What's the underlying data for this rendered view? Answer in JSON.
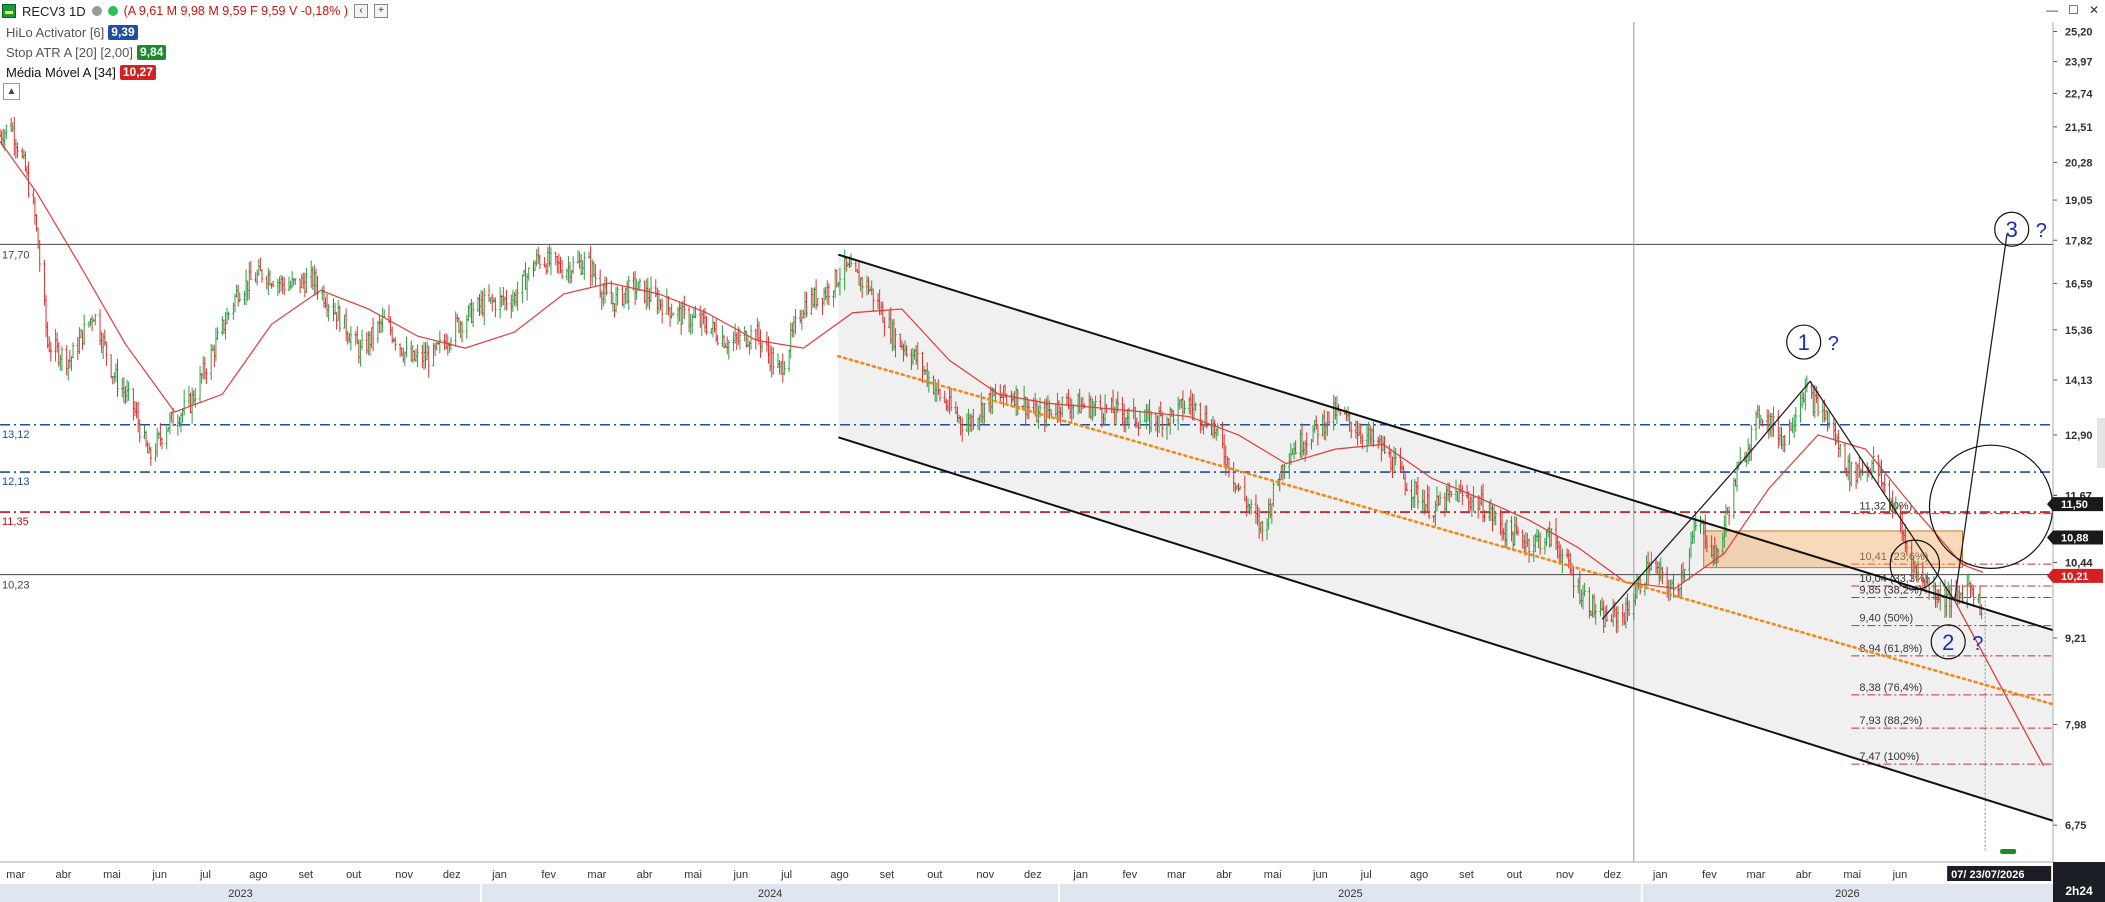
{
  "window": {
    "symbol": "RECV3 1D",
    "ohlc_text": "(A 9,61 M 9,98 M 9,59 F 9,59 V -0,18% )",
    "chevron_label": "‹",
    "add_label": "+",
    "min_label": "—",
    "max_label": "☐",
    "close_label": "✕",
    "collapse_label": "▲",
    "corner_label": "2h24"
  },
  "indicators": [
    {
      "label": "HiLo Activator [6]",
      "badge": "9,39",
      "badge_color": "#1f4fa0",
      "text_color": "#555555"
    },
    {
      "label": "Stop ATR A [20] [2,00]",
      "badge": "9,84",
      "badge_color": "#1c8a2e",
      "text_color": "#555555"
    },
    {
      "label": "Média Móvel A [34]",
      "badge": "10,27",
      "badge_color": "#d42020",
      "text_color": "#111111"
    }
  ],
  "colors": {
    "up": "#2e9e44",
    "down": "#d63434",
    "ma": "#e03c3c",
    "blue_dash": "#1f4fa0",
    "red_dash": "#c0101a",
    "orange": "#f08a1a",
    "channel_fill": "#f0f0f0",
    "fib_line": "#c03030",
    "wave": "#1d2db8"
  },
  "chart_data": {
    "type": "candlestick",
    "yscale": "log",
    "ylim": [
      6.35,
      25.6
    ],
    "x_range": [
      "2023-02-20",
      "2026-09-05"
    ],
    "y_ticks": [
      25.2,
      23.97,
      22.74,
      21.51,
      20.28,
      19.05,
      17.82,
      16.59,
      15.36,
      14.13,
      12.9,
      11.67,
      10.44,
      9.21,
      7.98,
      6.75
    ],
    "y_tick_labels": [
      "25,20",
      "23,97",
      "22,74",
      "21,51",
      "20,28",
      "19,05",
      "17,82",
      "16,59",
      "15,36",
      "14,13",
      "12,90",
      "11,67",
      "10,44",
      "9,21",
      "7,98",
      "6,75"
    ],
    "months": [
      {
        "date": "2023-03-01",
        "label": "mar"
      },
      {
        "date": "2023-04-01",
        "label": "abr"
      },
      {
        "date": "2023-05-01",
        "label": "mai"
      },
      {
        "date": "2023-06-01",
        "label": "jun"
      },
      {
        "date": "2023-07-01",
        "label": "jul"
      },
      {
        "date": "2023-08-01",
        "label": "ago"
      },
      {
        "date": "2023-09-01",
        "label": "set"
      },
      {
        "date": "2023-10-01",
        "label": "out"
      },
      {
        "date": "2023-11-01",
        "label": "nov"
      },
      {
        "date": "2023-12-01",
        "label": "dez"
      },
      {
        "date": "2024-01-01",
        "label": "jan"
      },
      {
        "date": "2024-02-01",
        "label": "fev"
      },
      {
        "date": "2024-03-01",
        "label": "mar"
      },
      {
        "date": "2024-04-01",
        "label": "abr"
      },
      {
        "date": "2024-05-01",
        "label": "mai"
      },
      {
        "date": "2024-06-01",
        "label": "jun"
      },
      {
        "date": "2024-07-01",
        "label": "jul"
      },
      {
        "date": "2024-08-01",
        "label": "ago"
      },
      {
        "date": "2024-09-01",
        "label": "set"
      },
      {
        "date": "2024-10-01",
        "label": "out"
      },
      {
        "date": "2024-11-01",
        "label": "nov"
      },
      {
        "date": "2024-12-01",
        "label": "dez"
      },
      {
        "date": "2025-01-01",
        "label": "jan"
      },
      {
        "date": "2025-02-01",
        "label": "fev"
      },
      {
        "date": "2025-03-01",
        "label": "mar"
      },
      {
        "date": "2025-04-01",
        "label": "abr"
      },
      {
        "date": "2025-05-01",
        "label": "mai"
      },
      {
        "date": "2025-06-01",
        "label": "jun"
      },
      {
        "date": "2025-07-01",
        "label": "jul"
      },
      {
        "date": "2025-08-01",
        "label": "ago"
      },
      {
        "date": "2025-09-01",
        "label": "set"
      },
      {
        "date": "2025-10-01",
        "label": "out"
      },
      {
        "date": "2025-11-01",
        "label": "nov"
      },
      {
        "date": "2025-12-01",
        "label": "dez"
      },
      {
        "date": "2026-01-01",
        "label": "jan"
      },
      {
        "date": "2026-02-01",
        "label": "fev"
      },
      {
        "date": "2026-03-01",
        "label": "mar"
      },
      {
        "date": "2026-04-01",
        "label": "abr"
      },
      {
        "date": "2026-05-01",
        "label": "mai"
      },
      {
        "date": "2026-06-01",
        "label": "jun"
      }
    ],
    "years": [
      {
        "start": "2023-02-20",
        "end": "2023-12-20",
        "label": "2023"
      },
      {
        "start": "2023-12-20",
        "end": "2024-12-18",
        "label": "2024"
      },
      {
        "start": "2024-12-18",
        "end": "2025-12-20",
        "label": "2025"
      },
      {
        "start": "2025-12-20",
        "end": "2026-09-05",
        "label": "2026"
      }
    ],
    "price_path": [
      [
        "2023-02-20",
        21.2
      ],
      [
        "2023-02-27",
        21.6
      ],
      [
        "2023-03-08",
        20.0
      ],
      [
        "2023-03-14",
        18.5
      ],
      [
        "2023-03-22",
        15.0
      ],
      [
        "2023-04-05",
        14.6
      ],
      [
        "2023-04-20",
        15.8
      ],
      [
        "2023-05-02",
        14.3
      ],
      [
        "2023-05-15",
        13.5
      ],
      [
        "2023-05-25",
        12.4
      ],
      [
        "2023-06-05",
        13.1
      ],
      [
        "2023-06-20",
        13.6
      ],
      [
        "2023-07-05",
        14.9
      ],
      [
        "2023-07-20",
        16.4
      ],
      [
        "2023-08-05",
        16.9
      ],
      [
        "2023-08-20",
        16.5
      ],
      [
        "2023-09-05",
        16.7
      ],
      [
        "2023-09-20",
        15.8
      ],
      [
        "2023-10-05",
        14.8
      ],
      [
        "2023-10-20",
        15.6
      ],
      [
        "2023-11-05",
        14.6
      ],
      [
        "2023-11-20",
        14.7
      ],
      [
        "2023-12-05",
        15.5
      ],
      [
        "2023-12-20",
        16.0
      ],
      [
        "2024-01-10",
        16.2
      ],
      [
        "2024-01-25",
        17.3
      ],
      [
        "2024-02-10",
        17.0
      ],
      [
        "2024-02-25",
        17.2
      ],
      [
        "2024-03-10",
        16.0
      ],
      [
        "2024-03-25",
        16.5
      ],
      [
        "2024-04-10",
        16.1
      ],
      [
        "2024-04-25",
        15.7
      ],
      [
        "2024-05-10",
        15.5
      ],
      [
        "2024-05-25",
        15.0
      ],
      [
        "2024-06-10",
        15.3
      ],
      [
        "2024-06-25",
        14.3
      ],
      [
        "2024-07-10",
        16.0
      ],
      [
        "2024-07-25",
        16.4
      ],
      [
        "2024-08-05",
        17.0
      ],
      [
        "2024-08-20",
        16.5
      ],
      [
        "2024-09-05",
        15.2
      ],
      [
        "2024-09-20",
        14.6
      ],
      [
        "2024-10-05",
        13.7
      ],
      [
        "2024-10-20",
        13.1
      ],
      [
        "2024-11-05",
        13.7
      ],
      [
        "2024-11-20",
        13.8
      ],
      [
        "2024-12-05",
        13.3
      ],
      [
        "2024-12-20",
        13.6
      ],
      [
        "2025-01-10",
        13.5
      ],
      [
        "2025-01-25",
        13.4
      ],
      [
        "2025-02-10",
        13.2
      ],
      [
        "2025-02-25",
        13.3
      ],
      [
        "2025-03-10",
        13.6
      ],
      [
        "2025-03-25",
        13.1
      ],
      [
        "2025-04-10",
        11.8
      ],
      [
        "2025-04-25",
        11.0
      ],
      [
        "2025-05-10",
        12.5
      ],
      [
        "2025-05-25",
        12.9
      ],
      [
        "2025-06-10",
        13.4
      ],
      [
        "2025-06-25",
        13.0
      ],
      [
        "2025-07-10",
        12.6
      ],
      [
        "2025-07-25",
        11.9
      ],
      [
        "2025-08-10",
        11.4
      ],
      [
        "2025-08-25",
        11.7
      ],
      [
        "2025-09-10",
        11.5
      ],
      [
        "2025-09-25",
        11.0
      ],
      [
        "2025-10-10",
        10.8
      ],
      [
        "2025-10-25",
        10.9
      ],
      [
        "2025-11-10",
        10.0
      ],
      [
        "2025-11-25",
        9.5
      ],
      [
        "2025-12-10",
        9.6
      ],
      [
        "2025-12-25",
        10.4
      ],
      [
        "2026-01-10",
        9.9
      ],
      [
        "2026-01-25",
        11.2
      ],
      [
        "2026-02-05",
        10.5
      ],
      [
        "2026-02-20",
        12.3
      ],
      [
        "2026-03-05",
        13.4
      ],
      [
        "2026-03-20",
        12.8
      ],
      [
        "2026-04-01",
        13.9
      ],
      [
        "2026-04-15",
        13.3
      ],
      [
        "2026-04-30",
        12.1
      ],
      [
        "2026-05-15",
        12.3
      ],
      [
        "2026-05-28",
        11.4
      ],
      [
        "2026-06-10",
        10.3
      ],
      [
        "2026-06-25",
        9.9
      ],
      [
        "2026-07-05",
        9.8
      ],
      [
        "2026-07-15",
        10.1
      ],
      [
        "2026-07-23",
        9.59
      ]
    ],
    "moving_average_path": [
      [
        "2023-02-20",
        21.0
      ],
      [
        "2023-03-15",
        19.3
      ],
      [
        "2023-04-10",
        17.2
      ],
      [
        "2023-05-10",
        15.0
      ],
      [
        "2023-06-10",
        13.4
      ],
      [
        "2023-07-10",
        13.8
      ],
      [
        "2023-08-10",
        15.5
      ],
      [
        "2023-09-10",
        16.4
      ],
      [
        "2023-10-10",
        15.9
      ],
      [
        "2023-11-10",
        15.2
      ],
      [
        "2023-12-10",
        14.9
      ],
      [
        "2024-01-10",
        15.3
      ],
      [
        "2024-02-10",
        16.3
      ],
      [
        "2024-03-10",
        16.6
      ],
      [
        "2024-04-10",
        16.3
      ],
      [
        "2024-05-10",
        15.8
      ],
      [
        "2024-06-10",
        15.1
      ],
      [
        "2024-07-10",
        14.9
      ],
      [
        "2024-08-10",
        15.8
      ],
      [
        "2024-09-10",
        15.9
      ],
      [
        "2024-10-10",
        14.6
      ],
      [
        "2024-11-10",
        13.8
      ],
      [
        "2024-12-10",
        13.6
      ],
      [
        "2025-01-10",
        13.5
      ],
      [
        "2025-02-10",
        13.4
      ],
      [
        "2025-03-10",
        13.3
      ],
      [
        "2025-04-10",
        12.9
      ],
      [
        "2025-05-10",
        12.3
      ],
      [
        "2025-06-10",
        12.6
      ],
      [
        "2025-07-10",
        12.7
      ],
      [
        "2025-08-10",
        12.0
      ],
      [
        "2025-09-10",
        11.6
      ],
      [
        "2025-10-10",
        11.2
      ],
      [
        "2025-11-10",
        10.7
      ],
      [
        "2025-12-10",
        10.1
      ],
      [
        "2026-01-10",
        10.0
      ],
      [
        "2026-02-10",
        10.6
      ],
      [
        "2026-03-10",
        11.8
      ],
      [
        "2026-04-10",
        12.9
      ],
      [
        "2026-05-10",
        12.6
      ],
      [
        "2026-06-10",
        11.4
      ],
      [
        "2026-07-10",
        10.4
      ],
      [
        "2026-07-23",
        10.27
      ]
    ],
    "h_lines": [
      {
        "value": 17.7,
        "label": "17,70",
        "style": "solid",
        "color": "#444444"
      },
      {
        "value": 13.12,
        "label": "13,12",
        "style": "dashdot",
        "color": "#1f4fa0"
      },
      {
        "value": 12.13,
        "label": "12,13",
        "style": "dashdot",
        "color": "#1f4fa0"
      },
      {
        "value": 11.35,
        "label": "11,35",
        "style": "dashdot",
        "color": "#c0101a"
      },
      {
        "value": 10.23,
        "label": "10,23",
        "style": "solid",
        "color": "#444444"
      }
    ],
    "vline_date": "2025-12-15",
    "channel": {
      "upper": [
        [
          "2024-08-01",
          17.4
        ],
        [
          "2026-09-05",
          9.33
        ]
      ],
      "lower": [
        [
          "2024-08-01",
          12.85
        ],
        [
          "2026-09-05",
          6.8
        ]
      ],
      "start": "2024-08-01"
    },
    "orange_trend": [
      [
        "2024-08-01",
        14.7
      ],
      [
        "2026-09-05",
        8.25
      ]
    ],
    "wave_lines": [
      [
        [
          "2025-11-25",
          9.5
        ],
        [
          "2026-02-20",
          12.3
        ],
        [
          "2026-04-05",
          14.1
        ],
        [
          "2026-07-05",
          9.8
        ],
        [
          "2026-08-07",
          18.0
        ]
      ],
      [
        [
          "2026-07-05",
          9.8
        ],
        [
          "2026-08-30",
          7.45
        ]
      ]
    ],
    "orange_box": {
      "start": "2026-01-28",
      "end": "2026-07-10",
      "top": 11.0,
      "bottom": 10.35
    },
    "fibonacci": {
      "start": "2026-05-01",
      "end": "2026-09-05",
      "levels": [
        {
          "value": 11.32,
          "label": "11,32 (0%)"
        },
        {
          "value": 10.41,
          "label": "10,41 (23,6%)"
        },
        {
          "value": 10.04,
          "label": "10,04 (33,3%)"
        },
        {
          "value": 9.85,
          "label": "9,85 (38,2%)"
        },
        {
          "value": 9.4,
          "label": "9,40 (50%)"
        },
        {
          "value": 8.94,
          "label": "8,94 (61,8%)"
        },
        {
          "value": 8.38,
          "label": "8,38 (76,4%)"
        },
        {
          "value": 7.93,
          "label": "7,93 (88,2%)"
        },
        {
          "value": 7.47,
          "label": "7,47 (100%)"
        }
      ]
    },
    "wave_labels": [
      {
        "date": "2026-04-01",
        "value": 15.05,
        "num": "1",
        "mark": "?"
      },
      {
        "date": "2026-07-01",
        "value": 9.15,
        "num": "2",
        "mark": "?"
      },
      {
        "date": "2026-08-10",
        "value": 18.15,
        "num": "3",
        "mark": "?"
      }
    ],
    "circles": [
      {
        "date": "2026-07-28",
        "value": 11.45,
        "r_ratio": 0.03
      },
      {
        "date": "2026-06-10",
        "value": 10.4,
        "r_ratio": 0.012
      }
    ],
    "price_tags": [
      {
        "value": 11.5,
        "label": "11,50",
        "bg": "#1a1a1a"
      },
      {
        "value": 10.88,
        "label": "10,88",
        "bg": "#1a1a1a"
      },
      {
        "value": 10.21,
        "label": "10,21",
        "bg": "#d42020"
      }
    ],
    "date_tag": "07/ 23/07/2026",
    "date_tag_date": "2026-07-23",
    "extra_ticks": [
      {
        "value": 11.67,
        "label": "11,67"
      },
      {
        "value": 10.44,
        "label": "10,44"
      }
    ]
  }
}
